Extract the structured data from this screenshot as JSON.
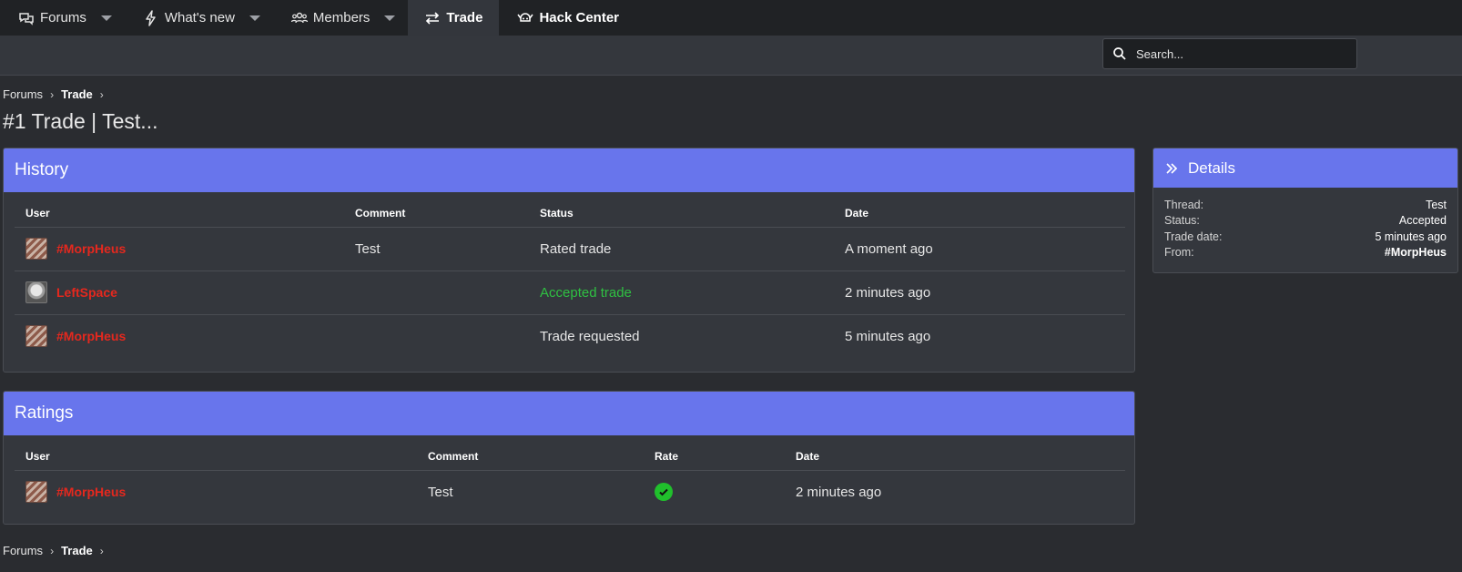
{
  "nav": {
    "items": [
      {
        "label": "Forums",
        "icon": "speech-bubbles-icon",
        "dropdown": true
      },
      {
        "label": "What's new",
        "icon": "lightning-icon",
        "dropdown": true
      },
      {
        "label": "Members",
        "icon": "users-icon",
        "dropdown": true
      },
      {
        "label": "Trade",
        "icon": "swap-arrows-icon",
        "active": true
      },
      {
        "label": "Hack Center",
        "icon": "horned-helmet-icon"
      }
    ]
  },
  "search": {
    "placeholder": "Search..."
  },
  "breadcrumb": {
    "root": "Forums",
    "current": "Trade"
  },
  "page": {
    "title": "#1 Trade | Test..."
  },
  "history": {
    "title": "History",
    "columns": [
      "User",
      "Comment",
      "Status",
      "Date"
    ],
    "rows": [
      {
        "user": "#MorpHeus",
        "comment": "Test",
        "status": "Rated trade",
        "date": "A moment ago"
      },
      {
        "user": "LeftSpace",
        "comment": "",
        "status": "Accepted trade",
        "date": "2 minutes ago"
      },
      {
        "user": "#MorpHeus",
        "comment": "",
        "status": "Trade requested",
        "date": "5 minutes ago"
      }
    ]
  },
  "ratings": {
    "title": "Ratings",
    "columns": [
      "User",
      "Comment",
      "Rate",
      "Date"
    ],
    "rows": [
      {
        "user": "#MorpHeus",
        "comment": "Test",
        "rate": "positive-check-icon",
        "date": "2 minutes ago"
      }
    ]
  },
  "details": {
    "title": "Details",
    "rows": [
      {
        "label": "Thread:",
        "value": "Test"
      },
      {
        "label": "Status:",
        "value": "Accepted"
      },
      {
        "label": "Trade date:",
        "value": "5 minutes ago"
      },
      {
        "label": "From:",
        "value": "#MorpHeus"
      }
    ]
  },
  "colors": {
    "accent": "#6875ec",
    "username": "#e5281e",
    "accepted": "#2fc042"
  }
}
